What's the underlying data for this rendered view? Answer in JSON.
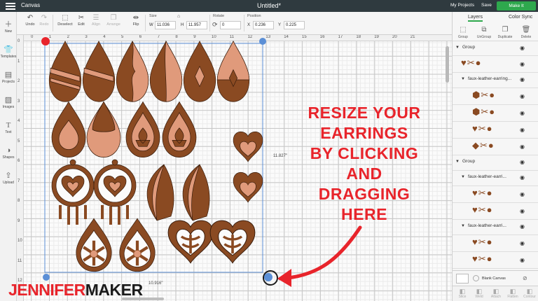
{
  "header": {
    "app_title": "Canvas",
    "doc_title": "Untitled*",
    "my_projects": "My Projects",
    "save": "Save",
    "make_it": "Make It"
  },
  "toolbar": {
    "undo": "Undo",
    "redo": "Redo",
    "deselect": "Deselect",
    "edit": "Edit",
    "align": "Align",
    "arrange": "Arrange",
    "flip": "Flip",
    "size_label": "Size",
    "w_label": "W",
    "w_value": "11.036",
    "h_label": "H",
    "h_value": "11.957",
    "rotate_label": "Rotate",
    "rotate_value": "0",
    "position_label": "Position",
    "x_label": "X",
    "x_value": "0.236",
    "y_label": "Y",
    "y_value": "0.225"
  },
  "sidebar": {
    "items": [
      {
        "label": "New",
        "icon": "plus-icon"
      },
      {
        "label": "Templates",
        "icon": "shirt-icon"
      },
      {
        "label": "Projects",
        "icon": "projects-icon"
      },
      {
        "label": "Images",
        "icon": "image-icon"
      },
      {
        "label": "Text",
        "icon": "text-icon"
      },
      {
        "label": "Shapes",
        "icon": "shapes-icon"
      },
      {
        "label": "Upload",
        "icon": "upload-icon"
      }
    ]
  },
  "canvas": {
    "ruler_top": [
      "0",
      "1",
      "2",
      "3",
      "4",
      "5",
      "6",
      "7",
      "8",
      "9",
      "10",
      "11",
      "12",
      "13",
      "14",
      "15",
      "16",
      "17",
      "18",
      "19",
      "20",
      "21"
    ],
    "ruler_left": [
      "0",
      "1",
      "2",
      "3",
      "4",
      "5",
      "6",
      "7",
      "8",
      "9",
      "10",
      "11",
      "12"
    ],
    "height_readout": "11.827\"",
    "width_readout": "10.916\""
  },
  "panel": {
    "tabs": [
      "Layers",
      "Color Sync"
    ],
    "buttons": [
      "Group",
      "UnGroup",
      "Duplicate",
      "Delete"
    ],
    "layers": [
      {
        "type": "group",
        "label": "Group"
      },
      {
        "type": "item"
      },
      {
        "type": "group",
        "label": "faux-leather-earring..."
      },
      {
        "type": "item"
      },
      {
        "type": "item"
      },
      {
        "type": "item"
      },
      {
        "type": "item"
      },
      {
        "type": "group",
        "label": "Group"
      },
      {
        "type": "group",
        "label": "faux-leather-earri..."
      },
      {
        "type": "item"
      },
      {
        "type": "item"
      },
      {
        "type": "group",
        "label": "faux-leather-earri..."
      },
      {
        "type": "item"
      },
      {
        "type": "item"
      }
    ],
    "blank_canvas": "Blank Canvas",
    "bottom_tools": [
      "Slice",
      "Weld",
      "Attach",
      "Flatten",
      "Contour"
    ]
  },
  "overlay": {
    "caption": [
      "RESIZE YOUR",
      "EARRINGS",
      "BY CLICKING",
      "AND",
      "DRAGGING",
      "HERE"
    ]
  },
  "brand": {
    "part1": "JENNIFER",
    "part2": "MAKER"
  },
  "colors": {
    "leather_dark": "#8a4a22",
    "leather_light": "#e09a7b",
    "accent_red": "#e8242b",
    "make_it_green": "#2ea84d",
    "header": "#2f3a3f",
    "selection": "#5b8fd6"
  }
}
